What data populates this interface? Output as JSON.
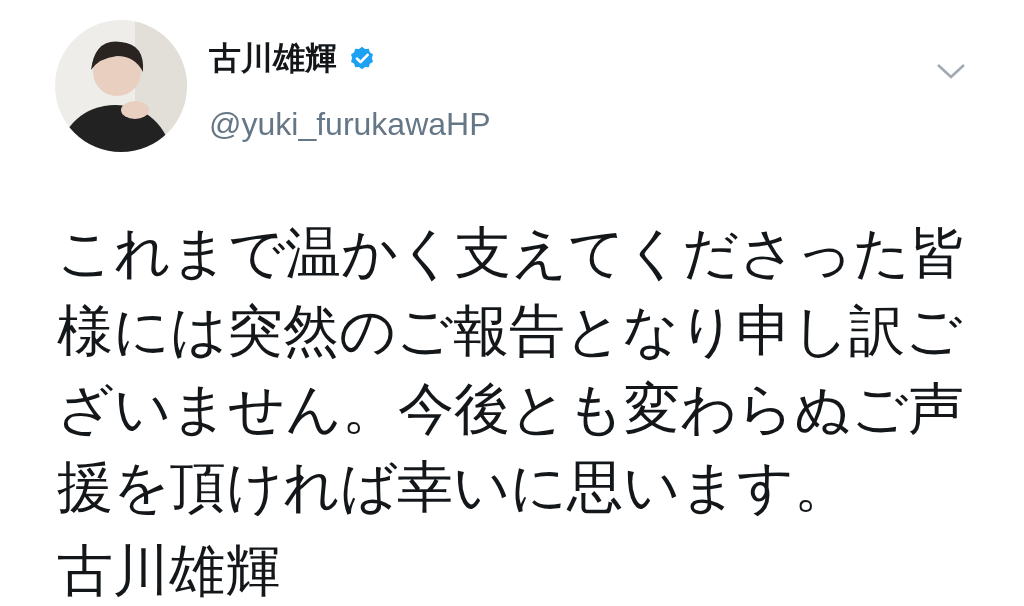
{
  "tweet": {
    "author": {
      "name": "古川雄輝",
      "verified": true,
      "handle": "@yuki_furukawaHP"
    },
    "body": "これまで温かく支えてくださった皆様には突然のご報告となり申し訳ございません。今後とも変わらぬご声援を頂ければ幸いに思います。",
    "signature": "古川雄輝"
  }
}
